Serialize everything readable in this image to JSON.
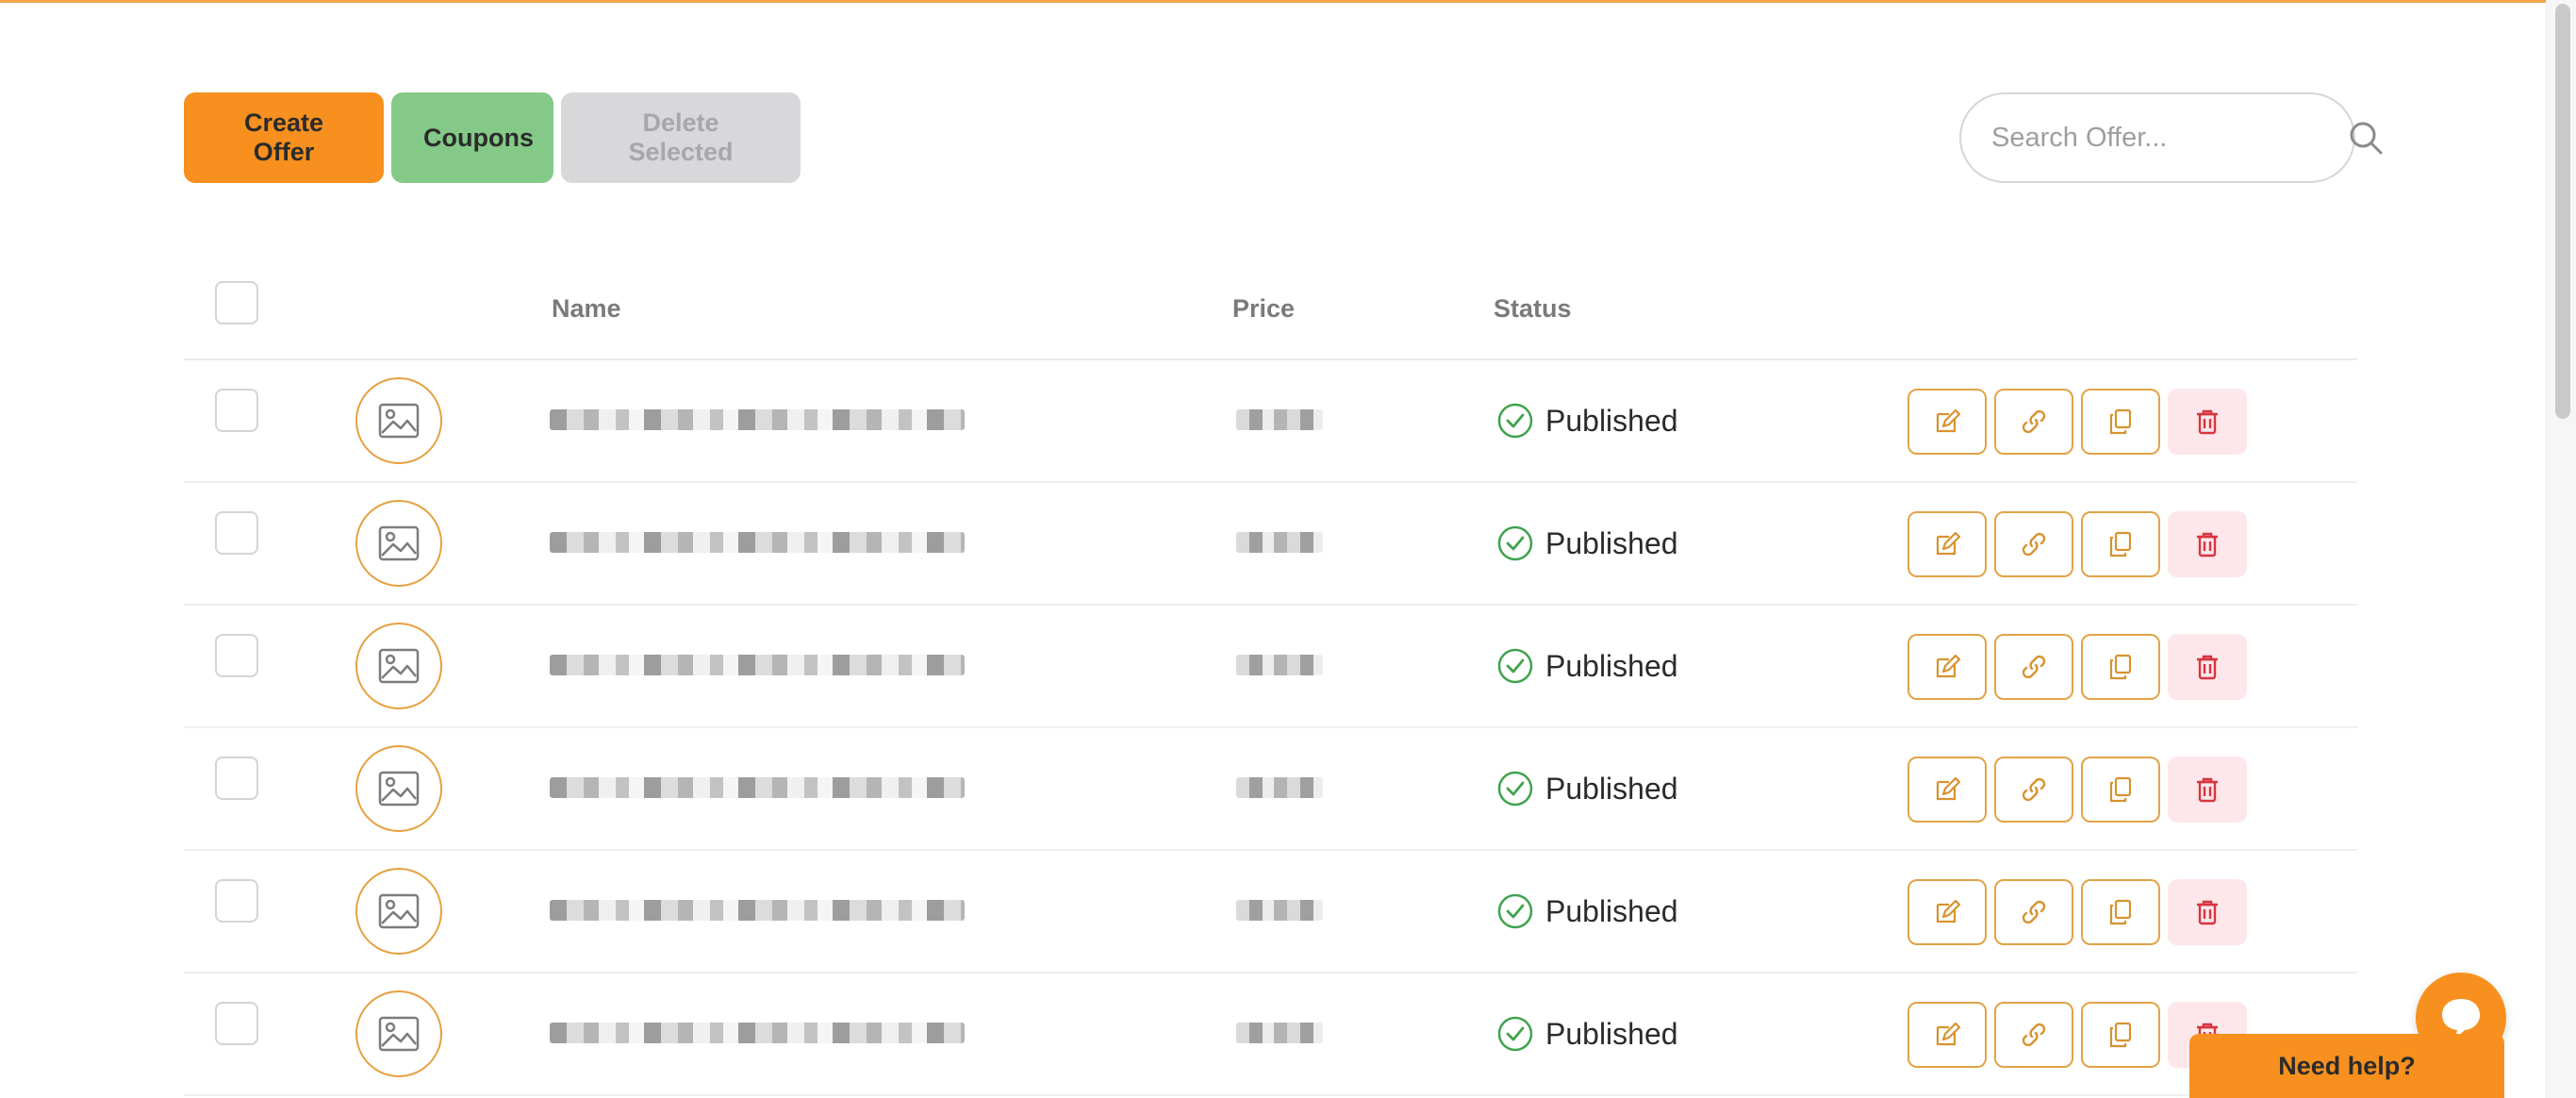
{
  "toolbar": {
    "create_label": "Create Offer",
    "coupons_label": "Coupons",
    "delete_label": "Delete Selected"
  },
  "search": {
    "placeholder": "Search Offer..."
  },
  "table": {
    "columns": {
      "name": "Name",
      "price": "Price",
      "status": "Status"
    },
    "rows": [
      {
        "status": "Published"
      },
      {
        "status": "Published"
      },
      {
        "status": "Published"
      },
      {
        "status": "Published"
      },
      {
        "status": "Published"
      },
      {
        "status": "Published"
      }
    ]
  },
  "help": {
    "label": "Need help?"
  },
  "colors": {
    "accent": "#f7901e",
    "coupons": "#84c987",
    "disabled": "#d8d8db",
    "published": "#3fa34d",
    "delete": "#d9343f"
  },
  "icons": {
    "search": "search-icon",
    "thumb": "image-placeholder-icon",
    "status": "check-circle-icon",
    "edit": "edit-icon",
    "link": "link-icon",
    "duplicate": "duplicate-icon",
    "delete": "trash-icon",
    "chat": "chat-icon"
  }
}
